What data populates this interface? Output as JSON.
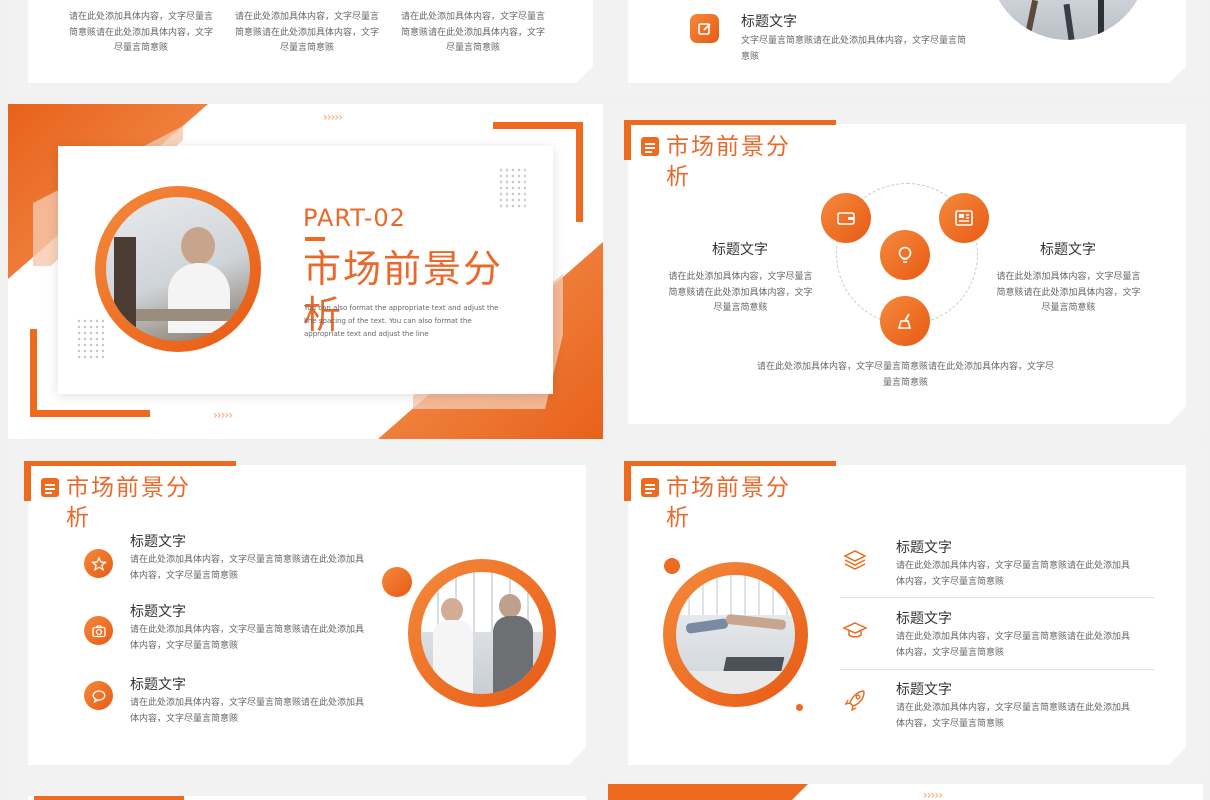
{
  "s1": {
    "paras": [
      "请在此处添加具体内容，文字尽量言简意赅请在此处添加具体内容，文字尽量言简意赅",
      "请在此处添加具体内容，文字尽量言简意赅请在此处添加具体内容，文字尽量言简意赅",
      "请在此处添加具体内容，文字尽量言简意赅请在此处添加具体内容，文字尽量言简意赅"
    ]
  },
  "s2": {
    "title": "标题文字",
    "desc": "文字尽量言简意赅请在此处添加具体内容，文字尽量言简意赅"
  },
  "s3": {
    "part": "PART-02",
    "title": "市场前景分析",
    "desc": "You can also format the appropriate text and adjust the line spacing of the text. You can also format the appropriate text and adjust the line",
    "chevrons": "›››››"
  },
  "s4": {
    "header": "市场前景分析",
    "left_title": "标题文字",
    "left_desc": "请在此处添加具体内容，文字尽量言简意赅请在此处添加具体内容，文字尽量言简意赅",
    "right_title": "标题文字",
    "right_desc": "请在此处添加具体内容，文字尽量言简意赅请在此处添加具体内容，文字尽量言简意赅",
    "bottom_desc": "请在此处添加具体内容，文字尽量言简意赅请在此处添加具体内容，文字尽量言简意赅"
  },
  "s5": {
    "header": "市场前景分析",
    "items": [
      {
        "title": "标题文字",
        "desc": "请在此处添加具体内容，文字尽量言简意赅请在此处添加具体内容，文字尽量言简意赅",
        "icon": "star-icon"
      },
      {
        "title": "标题文字",
        "desc": "请在此处添加具体内容，文字尽量言简意赅请在此处添加具体内容，文字尽量言简意赅",
        "icon": "camera-icon"
      },
      {
        "title": "标题文字",
        "desc": "请在此处添加具体内容，文字尽量言简意赅请在此处添加具体内容，文字尽量言简意赅",
        "icon": "chat-icon"
      }
    ]
  },
  "s6": {
    "header": "市场前景分析",
    "items": [
      {
        "title": "标题文字",
        "desc": "请在此处添加具体内容，文字尽量言简意赅请在此处添加具体内容，文字尽量言简意赅",
        "icon": "layers-icon"
      },
      {
        "title": "标题文字",
        "desc": "请在此处添加具体内容，文字尽量言简意赅请在此处添加具体内容，文字尽量言简意赅",
        "icon": "graduation-cap-icon"
      },
      {
        "title": "标题文字",
        "desc": "请在此处添加具体内容，文字尽量言简意赅请在此处添加具体内容，文字尽量言简意赅",
        "icon": "rocket-icon"
      }
    ]
  },
  "colors": {
    "accent": "#ed6a1e",
    "accent_light": "#f4a37a",
    "bg": "#f1f1f1"
  }
}
